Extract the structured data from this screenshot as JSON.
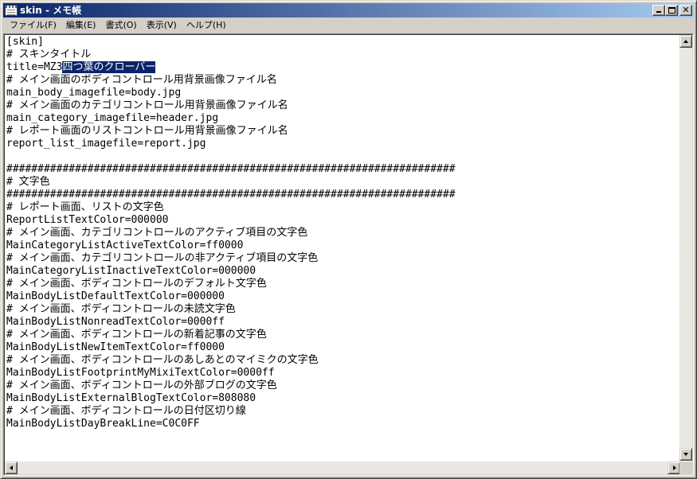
{
  "window": {
    "title": "skin - メモ帳",
    "icon": "notepad-icon"
  },
  "menu": [
    "ファイル(F)",
    "編集(E)",
    "書式(O)",
    "表示(V)",
    "ヘルプ(H)"
  ],
  "editor": {
    "lines": [
      "[skin]",
      "# スキンタイトル",
      "title=MZ3",
      "# メイン画面のボディコントロール用背景画像ファイル名",
      "main_body_imagefile=body.jpg",
      "# メイン画面のカテゴリコントロール用背景画像ファイル名",
      "main_category_imagefile=header.jpg",
      "# レポート画面のリストコントロール用背景画像ファイル名",
      "report_list_imagefile=report.jpg",
      "",
      "########################################################################",
      "# 文字色",
      "########################################################################",
      "# レポート画面、リストの文字色",
      "ReportListTextColor=000000",
      "# メイン画面、カテゴリコントロールのアクティブ項目の文字色",
      "MainCategoryListActiveTextColor=ff0000",
      "# メイン画面、カテゴリコントロールの非アクティブ項目の文字色",
      "MainCategoryListInactiveTextColor=000000",
      "# メイン画面、ボディコントロールのデフォルト文字色",
      "MainBodyListDefaultTextColor=000000",
      "# メイン画面、ボディコントロールの未読文字色",
      "MainBodyListNonreadTextColor=0000ff",
      "# メイン画面、ボディコントロールの新着記事の文字色",
      "MainBodyListNewItemTextColor=ff0000",
      "# メイン画面、ボディコントロールのあしあとのマイミクの文字色",
      "MainBodyListFootprintMyMixiTextColor=0000ff",
      "# メイン画面、ボディコントロールの外部ブログの文字色",
      "MainBodyListExternalBlogTextColor=808080",
      "# メイン画面、ボディコントロールの日付区切り線",
      "MainBodyListDayBreakLine=C0C0FF"
    ],
    "selected_text": "四つ葉のクローバー",
    "selected_line_index": 2
  },
  "colors": {
    "selection_bg": "#0a246a",
    "titlebar_start": "#0a246a",
    "titlebar_end": "#a6caf0",
    "face": "#d4d0c8"
  },
  "icons": {
    "minimize": "minimize-icon",
    "maximize": "maximize-icon",
    "close": "close-icon",
    "scroll_up": "arrow-up-icon",
    "scroll_down": "arrow-down-icon",
    "scroll_left": "arrow-left-icon",
    "scroll_right": "arrow-right-icon"
  }
}
